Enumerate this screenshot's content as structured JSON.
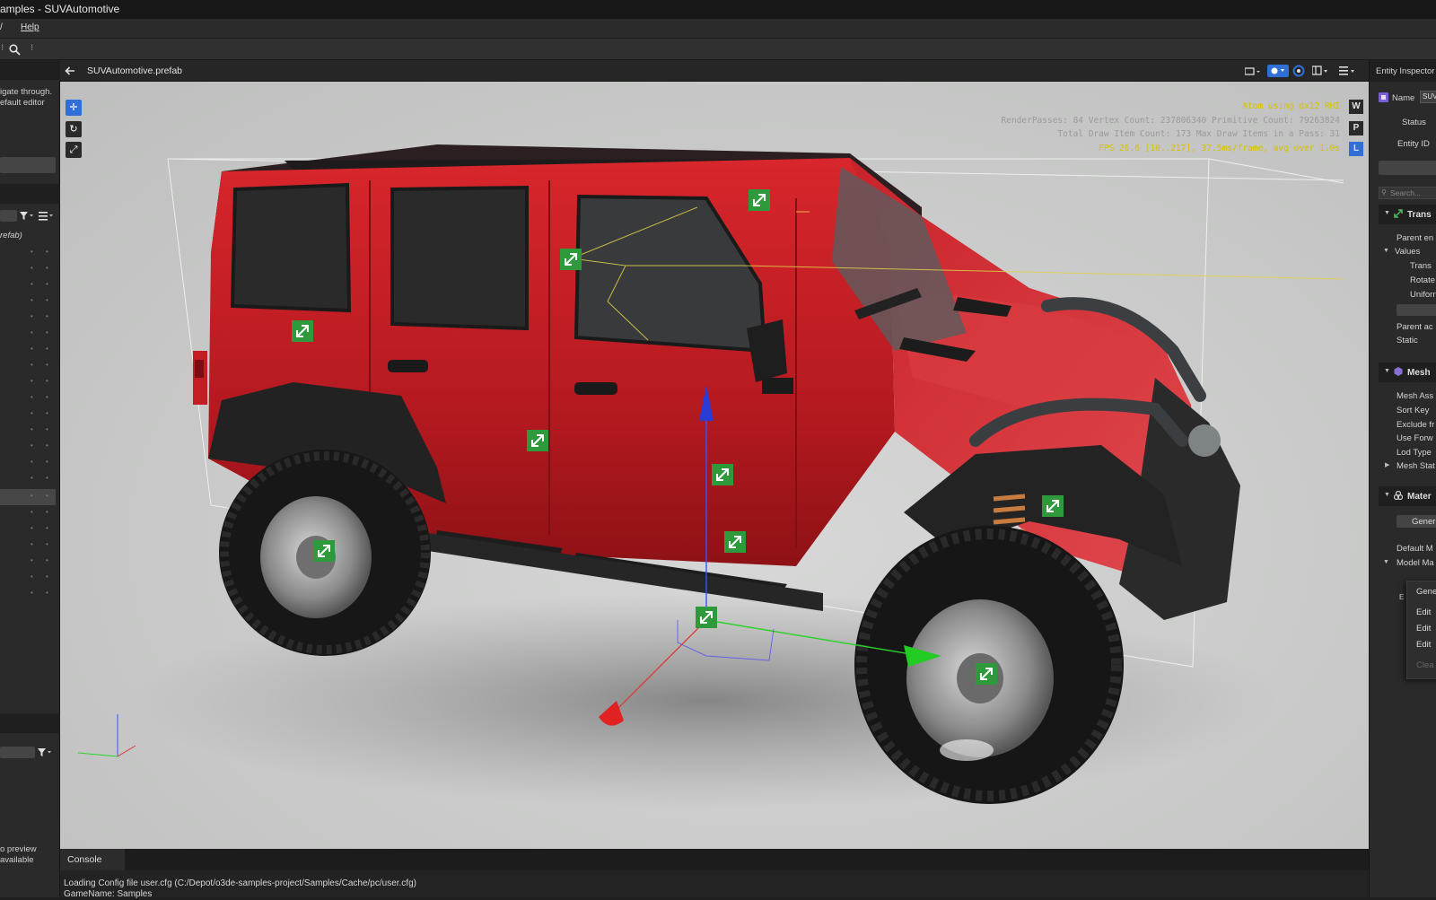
{
  "window": {
    "title": "amples - SUVAutomotive"
  },
  "menu": {
    "left_partial": "/",
    "help": "Help"
  },
  "left_panel": {
    "hint_line1": "igate through.",
    "hint_line2": "efault editor",
    "prefab_label": "refab)",
    "preview_line1": "o preview",
    "preview_line2": "available"
  },
  "viewport": {
    "tab_title": "SUVAutomotive.prefab",
    "stats": {
      "line1": "Atom using dx12 RHI",
      "line2": "RenderPasses: 84 Vertex Count: 237806340 Primitive Count: 79263824",
      "line3": "Total Draw Item Count: 173  Max Draw Items in a Pass: 31",
      "line4": "FPS 26.6 [10..217], 37.5ms/frame, avg over 1.0s"
    },
    "mode_buttons": [
      "W",
      "P",
      "L"
    ]
  },
  "console": {
    "tab_label": "Console",
    "line1": "Loading Config file user.cfg (C:/Depot/o3de-samples-project/Samples/Cache/pc/user.cfg)",
    "line2": "GameName: Samples"
  },
  "inspector": {
    "title": "Entity Inspector",
    "name_label": "Name",
    "name_value": "SUV",
    "status_label": "Status",
    "entity_id_label": "Entity ID",
    "search_placeholder": "Search...",
    "transform": {
      "title": "Trans",
      "parent_entity": "Parent en",
      "values": "Values",
      "translate": "Trans",
      "rotate": "Rotate",
      "uniform": "Uniforn",
      "parent_activation": "Parent ac",
      "static": "Static"
    },
    "mesh": {
      "title": "Mesh",
      "mesh_asset": "Mesh Ass",
      "sort_key": "Sort Key",
      "exclude": "Exclude fr",
      "use_forward": "Use Forw",
      "lod_type": "Lod Type",
      "mesh_stats": "Mesh Stat"
    },
    "material": {
      "title": "Mater",
      "generate_button": "Gener",
      "default_material": "Default M",
      "model_materials": "Model Ma",
      "partial_e": "E"
    },
    "context_menu": [
      "Gene",
      "Edit",
      "Edit",
      "Edit",
      "Clea"
    ]
  },
  "colors": {
    "car_body": "#c41d24",
    "gizmo_icon": "#2e9a3c",
    "accent_blue": "#2f6fd6",
    "stats_yellow": "#d6c400"
  }
}
